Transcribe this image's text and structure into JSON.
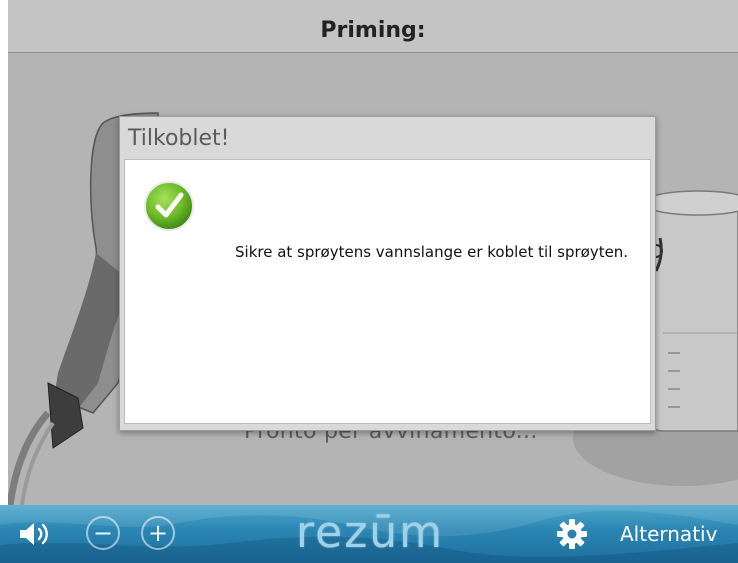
{
  "header": {
    "title": "Priming:"
  },
  "main": {
    "status_text": "Pronto per avvinamento..."
  },
  "dialog": {
    "title": "Tilkoblet!",
    "icon": "checkmark-icon",
    "message": "Sikre at sprøytens vannslange er koblet til sprøyten."
  },
  "footer": {
    "logo": "rezūm",
    "volume_icon": "speaker-icon",
    "volume_down_label": "−",
    "volume_up_label": "+",
    "options_icon": "gear-icon",
    "options_label": "Alternativ"
  },
  "colors": {
    "accent_green": "#6dbb2a",
    "footer_blue": "#2c87b4",
    "header_gray": "#c4c4c4"
  }
}
